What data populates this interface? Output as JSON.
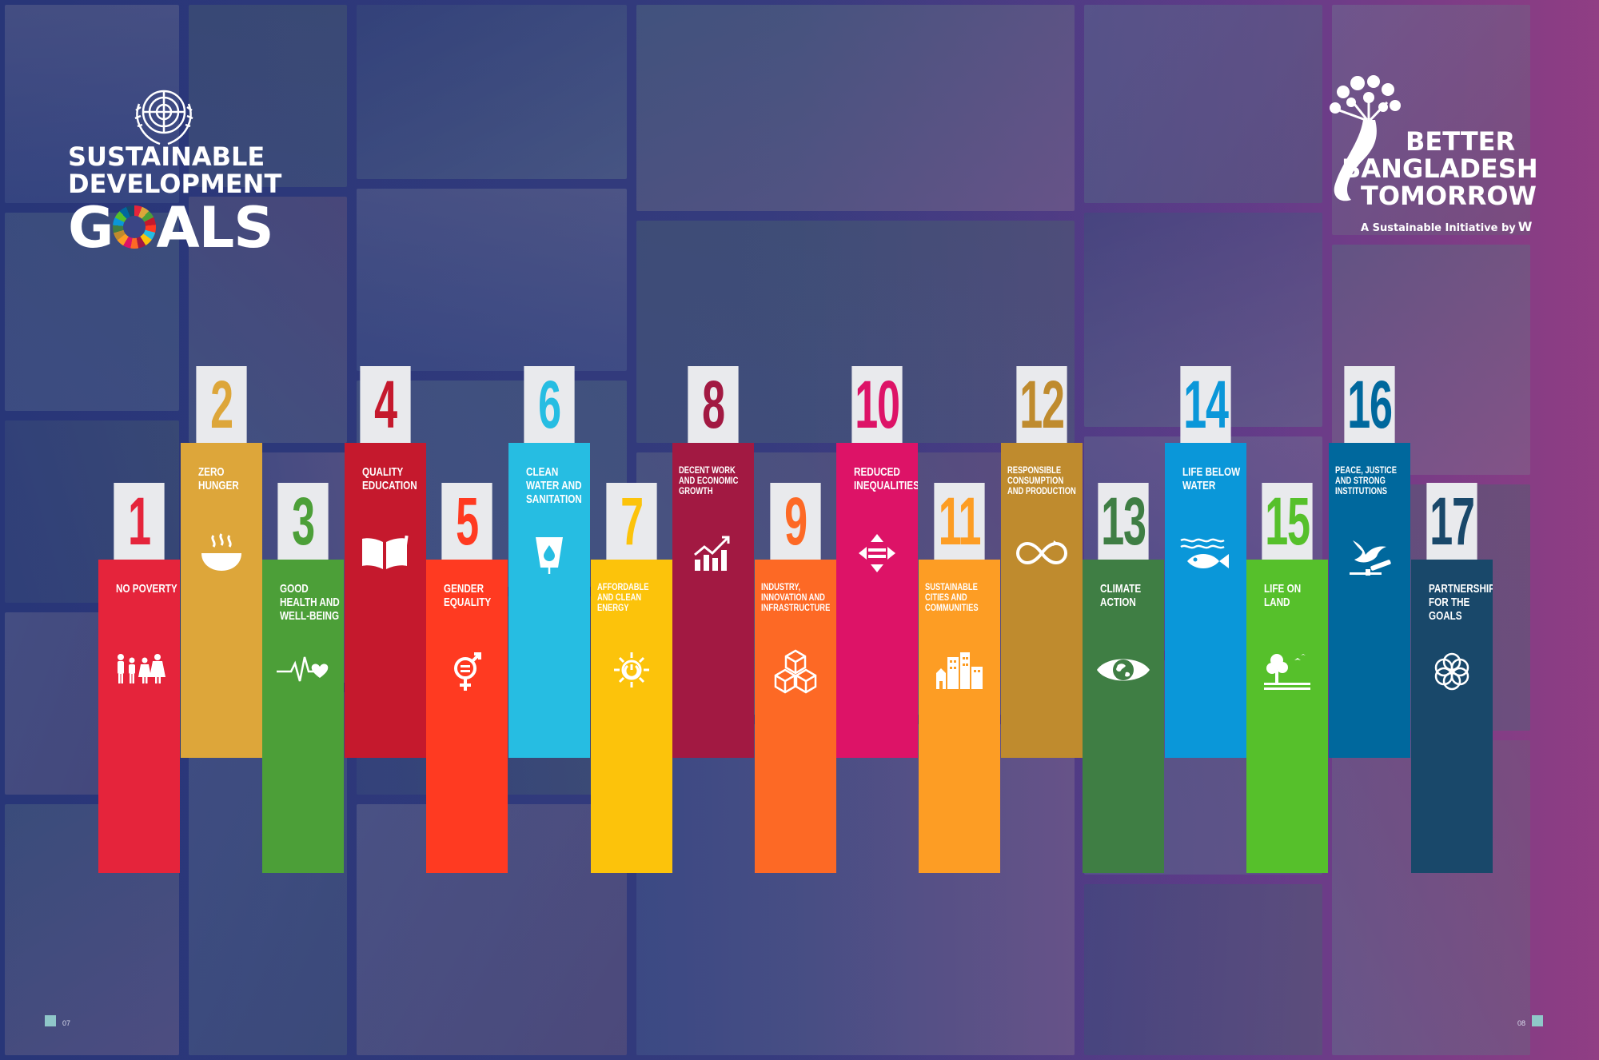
{
  "logos": {
    "sdg": {
      "line1": "SUSTAINABLE",
      "line2": "DEVELOPMENT",
      "line3_prefix": "G",
      "line3_suffix": "ALS"
    },
    "bbt": {
      "line1": "BETTER",
      "line2": "BANGLADESH",
      "line3": "TOMORROW",
      "tagline": "A Sustainable Initiative by",
      "mark": "W"
    }
  },
  "goals": [
    {
      "number": "1",
      "label": "NO POVERTY",
      "color": "#e5243b",
      "icon": "family-icon"
    },
    {
      "number": "2",
      "label": "ZERO HUNGER",
      "color": "#dda63a",
      "icon": "bowl-icon"
    },
    {
      "number": "3",
      "label": "GOOD HEALTH AND WELL-BEING",
      "color": "#4c9f38",
      "icon": "heartbeat-icon"
    },
    {
      "number": "4",
      "label": "QUALITY EDUCATION",
      "color": "#c5192d",
      "icon": "book-icon"
    },
    {
      "number": "5",
      "label": "GENDER EQUALITY",
      "color": "#ff3a21",
      "icon": "gender-equality-icon"
    },
    {
      "number": "6",
      "label": "CLEAN WATER AND SANITATION",
      "color": "#26bde2",
      "icon": "water-glass-icon"
    },
    {
      "number": "7",
      "label": "AFFORDABLE AND CLEAN ENERGY",
      "color": "#fcc30b",
      "icon": "sun-power-icon"
    },
    {
      "number": "8",
      "label": "DECENT WORK AND ECONOMIC GROWTH",
      "color": "#a21942",
      "icon": "growth-chart-icon"
    },
    {
      "number": "9",
      "label": "INDUSTRY, INNOVATION AND INFRASTRUCTURE",
      "color": "#fd6925",
      "icon": "cubes-icon"
    },
    {
      "number": "10",
      "label": "REDUCED INEQUALITIES",
      "color": "#dd1367",
      "icon": "equals-arrows-icon"
    },
    {
      "number": "11",
      "label": "SUSTAINABLE CITIES AND COMMUNITIES",
      "color": "#fd9d24",
      "icon": "city-icon"
    },
    {
      "number": "12",
      "label": "RESPONSIBLE CONSUMPTION AND PRODUCTION",
      "color": "#bf8b2e",
      "icon": "infinity-icon"
    },
    {
      "number": "13",
      "label": "CLIMATE ACTION",
      "color": "#3f7e44",
      "icon": "earth-eye-icon"
    },
    {
      "number": "14",
      "label": "LIFE BELOW WATER",
      "color": "#0a97d9",
      "icon": "fish-icon"
    },
    {
      "number": "15",
      "label": "LIFE ON LAND",
      "color": "#56c02b",
      "icon": "tree-icon"
    },
    {
      "number": "16",
      "label": "PEACE, JUSTICE AND STRONG INSTITUTIONS",
      "color": "#00689d",
      "icon": "dove-gavel-icon"
    },
    {
      "number": "17",
      "label": "PARTNERSHIPS FOR THE GOALS",
      "color": "#19486a",
      "icon": "rings-icon"
    }
  ],
  "pages": {
    "left": "07",
    "right": "08"
  }
}
